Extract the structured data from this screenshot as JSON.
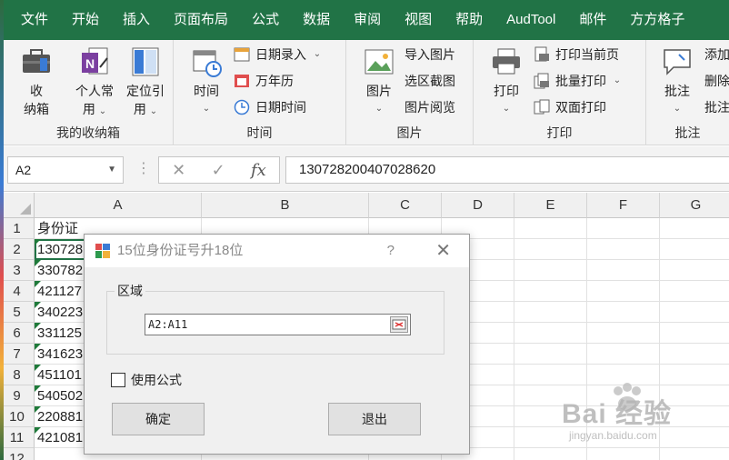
{
  "tabs": [
    "文件",
    "开始",
    "插入",
    "页面布局",
    "公式",
    "数据",
    "审阅",
    "视图",
    "帮助",
    "AudTool",
    "邮件",
    "方方格子"
  ],
  "ribbon": {
    "groups": {
      "toolbox": {
        "label": "我的收纳箱",
        "btn1_line1": "收",
        "btn1_line2": "纳箱",
        "btn2_line1": "个人常",
        "btn2_line2": "用",
        "btn3_line1": "定位引",
        "btn3_line2": "用"
      },
      "time": {
        "label": "时间",
        "big": "时间",
        "item1": "日期录入",
        "item2": "万年历",
        "item3": "日期时间"
      },
      "picture": {
        "label": "图片",
        "big": "图片",
        "item1": "导入图片",
        "item2": "选区截图",
        "item3": "图片阅览"
      },
      "print": {
        "label": "打印",
        "big": "打印",
        "item1": "打印当前页",
        "item2": "批量打印",
        "item3": "双面打印"
      },
      "comment": {
        "label": "批注",
        "big": "批注",
        "item1": "添加",
        "item2": "删除",
        "item3": "批注"
      }
    }
  },
  "formula_bar": {
    "name_box": "A2",
    "fx": "fx",
    "value": "130728200407028620"
  },
  "grid": {
    "columns": [
      "A",
      "B",
      "C",
      "D",
      "E",
      "F",
      "G"
    ],
    "rows": [
      "1",
      "2",
      "3",
      "4",
      "5",
      "6",
      "7",
      "8",
      "9",
      "10",
      "11",
      "12"
    ],
    "a_values": [
      "身份证",
      "130728",
      "330782",
      "421127",
      "340223",
      "331125",
      "341623",
      "451101",
      "540502",
      "220881",
      "421081",
      ""
    ]
  },
  "dialog": {
    "title": "15位身份证号升18位",
    "help": "?",
    "close": "✕",
    "group_label": "区域",
    "range_value": "A2:A11",
    "checkbox_label": "使用公式",
    "ok_button": "确定",
    "exit_button": "退出"
  },
  "watermark": {
    "main": "Bai 经验",
    "sub": "jingyan.baidu.com"
  },
  "colors": {
    "excel_green": "#217346",
    "ribbon_bg": "#f3f3f3",
    "dialog_bg": "#f0f0f0"
  }
}
